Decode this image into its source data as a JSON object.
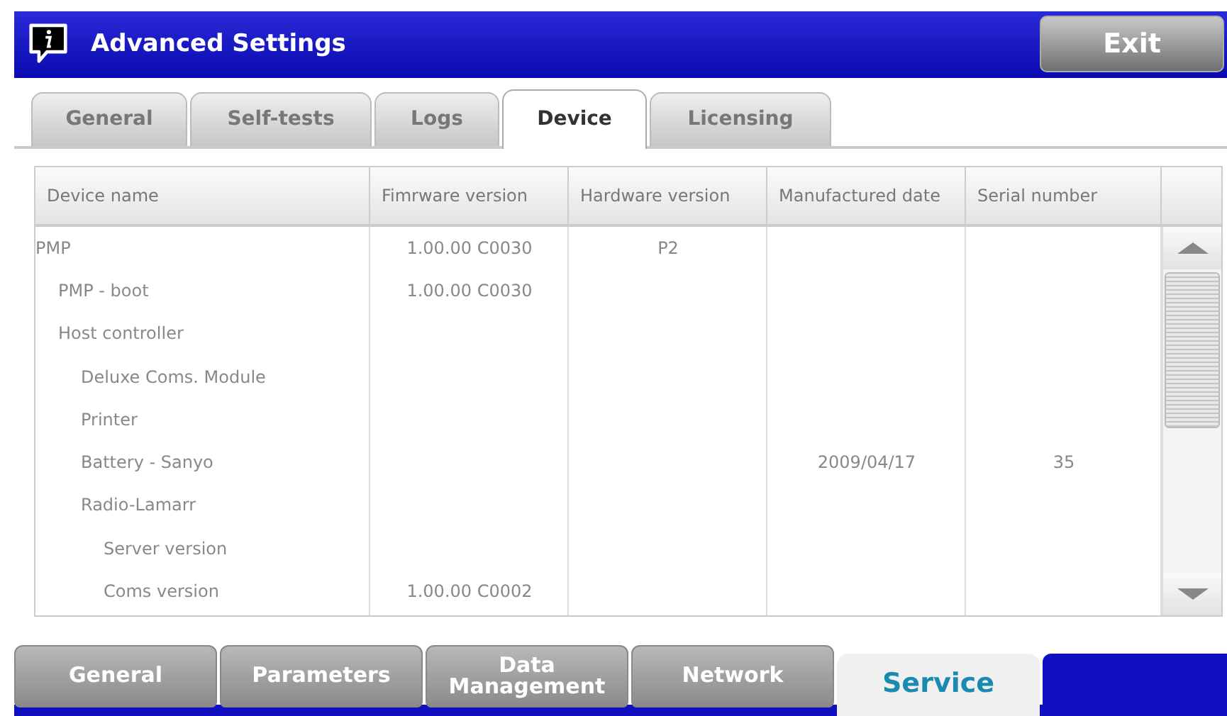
{
  "window": {
    "title": "Advanced Settings",
    "exit_button": "Exit"
  },
  "tabs": [
    {
      "label": "General",
      "selected": false
    },
    {
      "label": "Self-tests",
      "selected": false
    },
    {
      "label": "Logs",
      "selected": false
    },
    {
      "label": "Device",
      "selected": true
    },
    {
      "label": "Licensing",
      "selected": false
    }
  ],
  "table": {
    "columns": [
      "Device name",
      "Fimrware version",
      "Hardware version",
      "Manufactured date",
      "Serial number"
    ],
    "rows": [
      {
        "name": "PMP",
        "firmware": "1.00.00 C0030",
        "hardware": "P2",
        "children": [
          {
            "name": "PMP - boot",
            "firmware": "1.00.00 C0030"
          },
          {
            "name": "Host controller",
            "children": [
              {
                "name": "Deluxe Coms. Module"
              },
              {
                "name": "Printer"
              },
              {
                "name": "Battery - Sanyo",
                "date": "2009/04/17",
                "serial": "35"
              },
              {
                "name": "Radio-Lamarr",
                "children": [
                  {
                    "name": "Server version"
                  },
                  {
                    "name": "Coms version",
                    "firmware": "1.00.00 C0002"
                  }
                ]
              }
            ]
          }
        ]
      }
    ]
  },
  "bottom_tabs": [
    {
      "label": "General",
      "selected": false
    },
    {
      "label": "Parameters",
      "selected": false
    },
    {
      "label": "Data Management",
      "selected": false
    },
    {
      "label": "Network",
      "selected": false
    },
    {
      "label": "Service",
      "selected": true
    }
  ]
}
